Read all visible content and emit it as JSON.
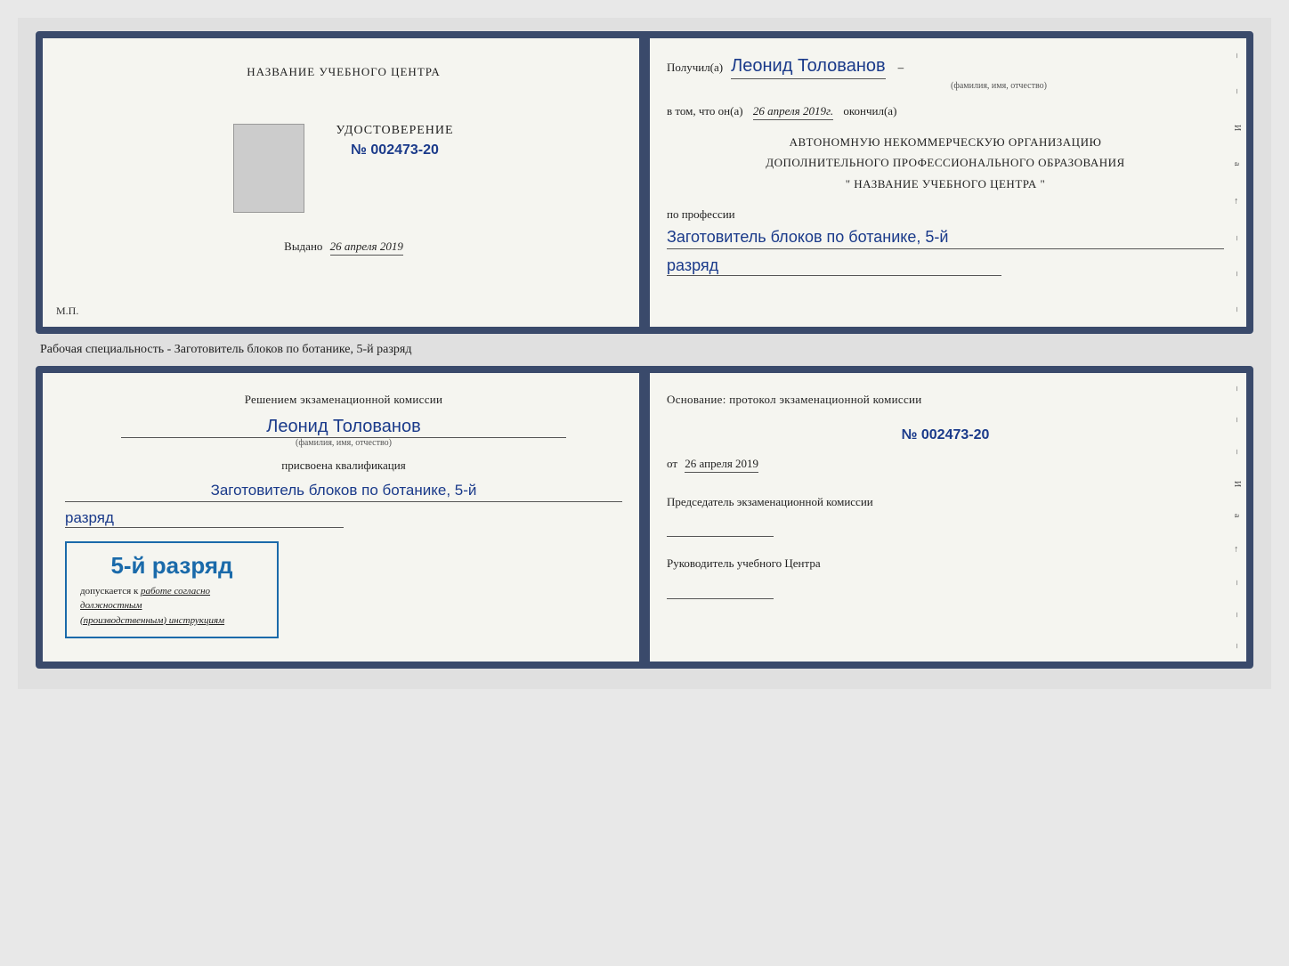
{
  "page": {
    "background": "#e0e0e0"
  },
  "top_document": {
    "left": {
      "org_name": "НАЗВАНИЕ УЧЕБНОГО ЦЕНТРА",
      "cert_title": "УДОСТОВЕРЕНИЕ",
      "cert_number_prefix": "№",
      "cert_number": "002473-20",
      "issued_label": "Выдано",
      "issued_date": "26 апреля 2019",
      "mp_label": "М.П."
    },
    "right": {
      "received_prefix": "Получил(а)",
      "recipient_name": "Леонид Толованов",
      "fio_label": "(фамилия, имя, отчество)",
      "date_prefix": "в том, что он(а)",
      "date_value": "26 апреля 2019г.",
      "completed_label": "окончил(а)",
      "org_line1": "АВТОНОМНУЮ НЕКОММЕРЧЕСКУЮ ОРГАНИЗАЦИЮ",
      "org_line2": "ДОПОЛНИТЕЛЬНОГО ПРОФЕССИОНАЛЬНОГО ОБРАЗОВАНИЯ",
      "org_line3": "\" НАЗВАНИЕ УЧЕБНОГО ЦЕНТРА \"",
      "profession_label": "по профессии",
      "profession_value": "Заготовитель блоков по ботанике, 5-й",
      "razryad_value": "разряд"
    }
  },
  "specialty_label": "Рабочая специальность - Заготовитель блоков по ботанике, 5-й разряд",
  "bottom_document": {
    "left": {
      "decision_text": "Решением экзаменационной комиссии",
      "person_name": "Леонид Толованов",
      "fio_label": "(фамилия, имя, отчество)",
      "qualification_label": "присвоена квалификация",
      "qualification_value": "Заготовитель блоков по ботанике, 5-й",
      "razryad_value": "разряд",
      "stamp_grade": "5-й разряд",
      "stamp_admission": "допускается к",
      "stamp_underline": "работе согласно должностным",
      "stamp_italic": "(производственным) инструкциям"
    },
    "right": {
      "osnov_label": "Основание: протокол экзаменационной комиссии",
      "protocol_number": "№ 002473-20",
      "from_prefix": "от",
      "from_date": "26 апреля 2019",
      "chairman_label": "Председатель экзаменационной комиссии",
      "director_label": "Руководитель учебного Центра"
    }
  },
  "side_marks": {
    "mark1": "И",
    "mark2": "а",
    "mark3": "←",
    "mark4": "–",
    "mark5": "–",
    "mark6": "–"
  }
}
